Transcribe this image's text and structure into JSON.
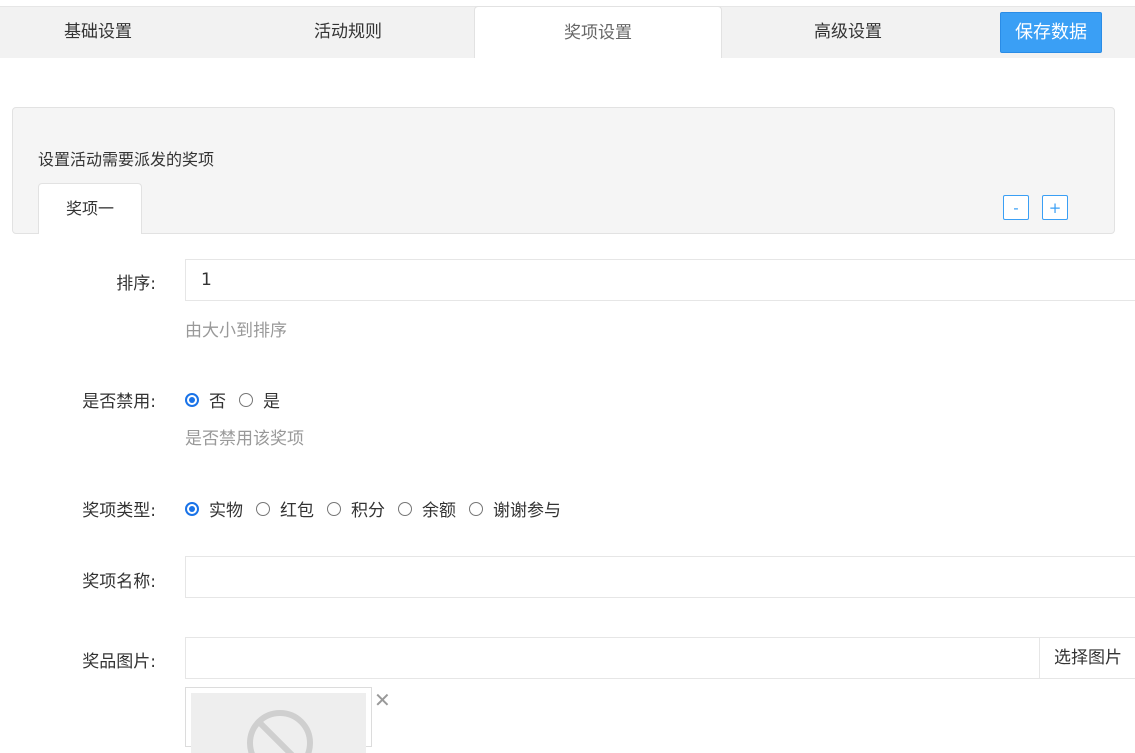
{
  "tabs": [
    {
      "label": "基础设置"
    },
    {
      "label": "活动规则"
    },
    {
      "label": "奖项设置"
    },
    {
      "label": "高级设置"
    }
  ],
  "save_label": "保存数据",
  "panel": {
    "description": "设置活动需要派发的奖项",
    "prize_tab": "奖项一",
    "minus_label": "-",
    "plus_label": "+"
  },
  "form": {
    "sort": {
      "label": "排序:",
      "value": "1",
      "hint": "由大小到排序"
    },
    "disabled": {
      "label": "是否禁用:",
      "options": [
        "否",
        "是"
      ],
      "hint": "是否禁用该奖项"
    },
    "prize_type": {
      "label": "奖项类型:",
      "options": [
        "实物",
        "红包",
        "积分",
        "余额",
        "谢谢参与"
      ]
    },
    "prize_name": {
      "label": "奖项名称:",
      "value": ""
    },
    "prize_image": {
      "label": "奖品图片:",
      "value": "",
      "button": "选择图片",
      "remove": "✕"
    }
  },
  "colors": {
    "accent": "#3a9ff5",
    "radio": "#1a73e8"
  }
}
